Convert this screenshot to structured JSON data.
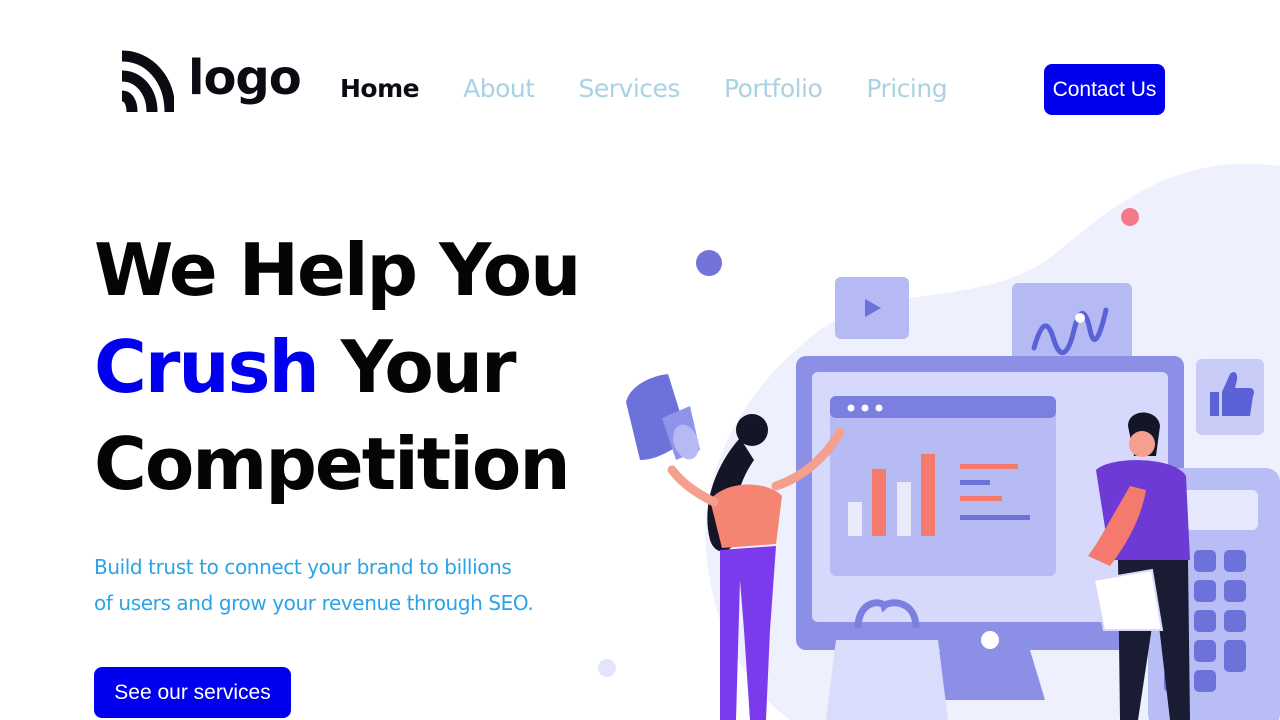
{
  "header": {
    "logo_text": "logo",
    "nav": [
      {
        "label": "Home",
        "active": true
      },
      {
        "label": "About",
        "active": false
      },
      {
        "label": "Services",
        "active": false
      },
      {
        "label": "Portfolio",
        "active": false
      },
      {
        "label": "Pricing",
        "active": false
      }
    ],
    "contact_label": "Contact Us"
  },
  "hero": {
    "line1": "We Help You",
    "line2_accent": "Crush",
    "line2_rest": " Your",
    "line3": "Competition",
    "subtext": "Build trust to connect your brand to billions of users and grow your revenue through SEO.",
    "cta_label": "See our services"
  },
  "colors": {
    "brand": "#0000ee",
    "nav_inactive": "#a9d2e4",
    "subtext": "#2aa3e8",
    "illustration_primary": "#7b80e0",
    "illustration_accent": "#f47a6e"
  },
  "icons": [
    "wifi-signal-logo-icon",
    "play-icon",
    "thumbs-up-icon",
    "megaphone-icon",
    "shopping-bag-icon",
    "calculator-icon"
  ]
}
